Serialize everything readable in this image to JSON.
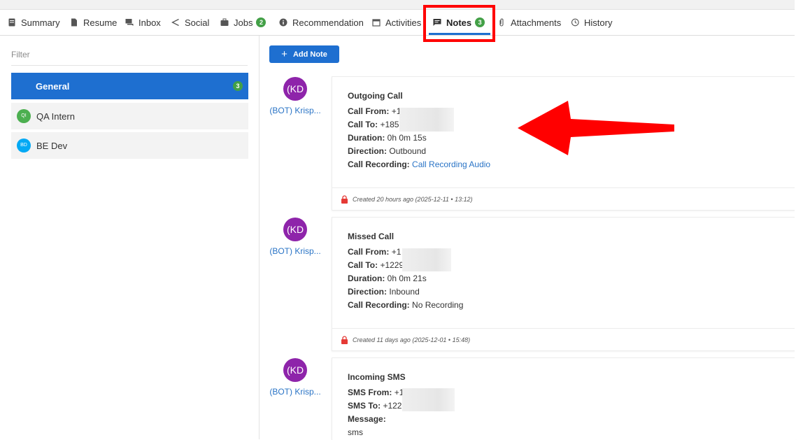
{
  "tabs": [
    {
      "label": "Summary",
      "icon": "document-icon"
    },
    {
      "label": "Resume",
      "icon": "file-icon"
    },
    {
      "label": "Inbox",
      "icon": "chat-icon"
    },
    {
      "label": "Social",
      "icon": "share-icon"
    },
    {
      "label": "Jobs",
      "icon": "briefcase-icon",
      "badge": "2"
    },
    {
      "label": "Recommendation",
      "icon": "info-icon"
    },
    {
      "label": "Activities",
      "icon": "calendar-icon"
    },
    {
      "label": "Notes",
      "icon": "note-icon",
      "badge": "3",
      "active": true
    },
    {
      "label": "Attachments",
      "icon": "paperclip-icon"
    },
    {
      "label": "History",
      "icon": "history-icon"
    }
  ],
  "filter": {
    "label": "Filter",
    "groups": [
      {
        "label": "General",
        "count": "3",
        "selected": true
      },
      {
        "label": "QA Intern",
        "initials": "QI",
        "color": "#4caf50"
      },
      {
        "label": "BE Dev",
        "initials": "BD",
        "color": "#03a9f4"
      }
    ]
  },
  "add_note_label": "Add Note",
  "notes": [
    {
      "avatar": "(KD",
      "author": "(BOT) Krisp...",
      "title": "Outgoing Call",
      "lines": [
        {
          "label": "Call From:",
          "value": "+1"
        },
        {
          "label": "Call To:",
          "value": "+185"
        },
        {
          "label": "Duration:",
          "value": "0h 0m 15s"
        },
        {
          "label": "Direction:",
          "value": "Outbound"
        },
        {
          "label": "Call Recording:",
          "value": "Call Recording Audio",
          "link": true
        }
      ],
      "footer": "Created 20 hours ago (2025-12-11 • 13:12)"
    },
    {
      "avatar": "(KD",
      "author": "(BOT) Krisp...",
      "title": "Missed Call",
      "lines": [
        {
          "label": "Call From:",
          "value": "+1"
        },
        {
          "label": "Call To:",
          "value": "+1229"
        },
        {
          "label": "Duration:",
          "value": "0h 0m 21s"
        },
        {
          "label": "Direction:",
          "value": "Inbound"
        },
        {
          "label": "Call Recording:",
          "value": "No Recording"
        }
      ],
      "footer": "Created 11 days ago (2025-12-01 • 15:48)"
    },
    {
      "avatar": "(KD",
      "author": "(BOT) Krisp...",
      "title": "Incoming SMS",
      "lines": [
        {
          "label": "SMS From:",
          "value": "+1"
        },
        {
          "label": "SMS To:",
          "value": "+1229"
        },
        {
          "label": "Message:",
          "value": ""
        }
      ],
      "message": "sms"
    }
  ],
  "colors": {
    "accent": "#1e6fd0",
    "badge": "#43a047",
    "avatar": "#8e24aa",
    "link": "#2a74c6",
    "annotation": "#ff0000"
  }
}
